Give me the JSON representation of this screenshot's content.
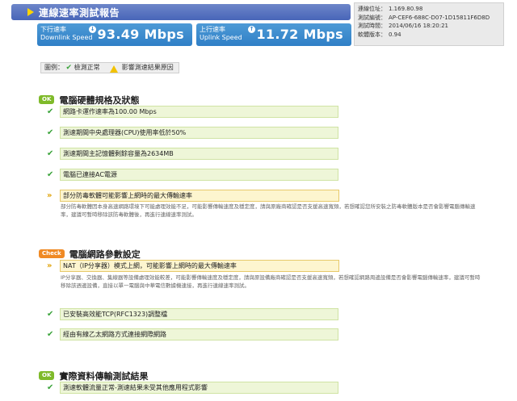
{
  "header": {
    "title": "連線速率測試報告"
  },
  "speeds": {
    "download": {
      "label_cn": "下行速率",
      "label_en": "Downlink Speed",
      "value": "93.49 Mbps",
      "icon": "download-arrow-icon"
    },
    "upload": {
      "label_cn": "上行速率",
      "label_en": "Uplink Speed",
      "value": "11.72 Mbps",
      "icon": "upload-arrow-icon"
    }
  },
  "info": {
    "rows": [
      {
        "key": "連線位址：",
        "value": "1.169.80.98"
      },
      {
        "key": "測試編號：",
        "value": "AP-CEF6-688C-D07-1D15811F6D8D"
      },
      {
        "key": "測試時間：",
        "value": "2014/06/16 18:20:21"
      },
      {
        "key": "軟體版本：",
        "value": "0.94"
      }
    ]
  },
  "legend": {
    "prefix": "圖例：",
    "ok_label": "檢測正常",
    "warn_label": "影響測速結果原因"
  },
  "sections": [
    {
      "badge": "OK",
      "title": "電腦硬體規格及狀態",
      "items": [
        {
          "status": "ok",
          "text": "網路卡運作速率為100.00 Mbps"
        },
        {
          "status": "ok",
          "text": "測速期間中央處理器(CPU)使用率低於50%"
        },
        {
          "status": "ok",
          "text": "測速期間主記憶體剩餘容量為2634MB"
        },
        {
          "status": "ok",
          "text": "電腦已連接AC電源"
        },
        {
          "status": "warn",
          "text": "部分防毒軟體可能影響上網時的最大傳輸速率",
          "desc": "部分防毒軟體因本身高速網路環境下可能處理效能不足，可能影響傳輸速度及穩定度，請與原廠商確認是否支援高速寬頻，若想確認您所安裝之防毒軟體版本是否會影響電腦傳輸速率，建議可暫時移除該防毒軟體後，再進行連線速率測試。"
        }
      ]
    },
    {
      "badge": "Check",
      "title": "電腦網路參數設定",
      "items": [
        {
          "status": "warn",
          "text": "NAT（IP分享器）模式上網，可能影響上網時的最大傳輸速率",
          "desc": "IP分享器、交換器、集線器等設備處理效能較差，可能影響傳輸速度及穩定度，請與原設備廠商確認是否支援高速寬頻，若想確認網路周邊設備是否會影響電腦傳輸速率，建議可暫時移除該週邊設備，直接以單一電腦與中華電信數據機連接，再進行連線速率測試。"
        },
        {
          "status": "ok",
          "text": "已安裝高效能TCP(RFC1323)調整檔"
        },
        {
          "status": "ok",
          "text": "經由有線乙太網路方式連接網際網路"
        }
      ]
    },
    {
      "badge": "OK",
      "title": "實際資料傳輸測試結果",
      "items": [
        {
          "status": "ok",
          "text": "測速軟體流量正常-測速結果未受其他應用程式影響"
        }
      ]
    }
  ],
  "colors": {
    "title_bar": "#4865b8",
    "speed_box": "#2f7fc6",
    "ok_green": "#3aa33a",
    "badge_ok": "#7fba2a",
    "badge_check": "#f08a24",
    "warn_yellow": "#e0a000"
  }
}
